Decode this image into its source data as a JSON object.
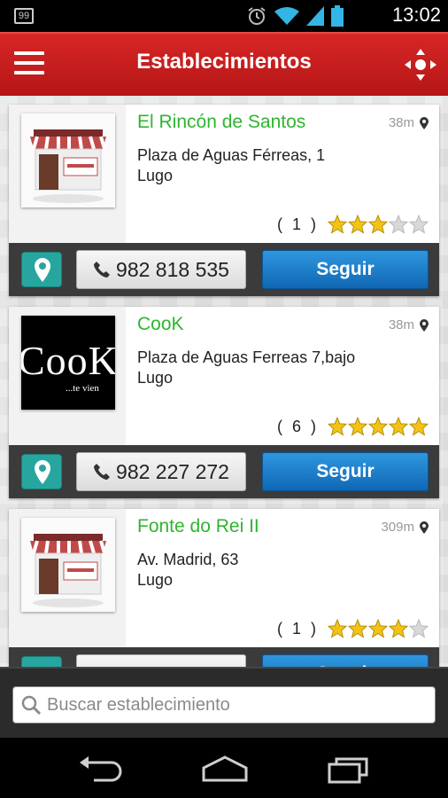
{
  "status_bar": {
    "notification_count": "99",
    "time": "13:02",
    "icons": [
      "alarm-icon",
      "wifi-icon",
      "signal-icon",
      "battery-icon"
    ]
  },
  "app_bar": {
    "title": "Establecimientos",
    "menu_icon": "hamburger-menu-icon",
    "locate_icon": "locate-crosshair-icon",
    "color": "#c91f1f"
  },
  "establishments": [
    {
      "name": "El Rincón de Santos",
      "distance": "38m",
      "address_line1": "Plaza de Aguas Férreas, 1",
      "address_line2": "Lugo",
      "rating_count": "( 1 )",
      "stars": 3,
      "phone": "982 818 535",
      "follow_label": "Seguir",
      "thumbnail": "shop-storefront"
    },
    {
      "name": "CooK",
      "distance": "38m",
      "address_line1": "Plaza de Aguas Ferreas 7,bajo",
      "address_line2": "Lugo",
      "rating_count": "( 6 )",
      "stars": 5,
      "phone": "982 227 272",
      "follow_label": "Seguir",
      "thumbnail": "cook-logo",
      "logo_text": "CooK",
      "logo_subtext": "...te vien"
    },
    {
      "name": "Fonte do Rei II",
      "distance": "309m",
      "address_line1": "Av. Madrid, 63",
      "address_line2": "Lugo",
      "rating_count": "( 1 )",
      "stars": 4,
      "phone": "",
      "follow_label": "Seguir",
      "thumbnail": "shop-storefront"
    }
  ],
  "search": {
    "placeholder": "Buscar establecimiento",
    "icon": "search-icon"
  },
  "colors": {
    "name_green": "#2fb52f",
    "follow_blue": "#1a7fcf",
    "map_teal": "#27a6a0",
    "star_gold": "#f2c316"
  },
  "nav_bar": {
    "icons": [
      "back-icon",
      "home-icon",
      "recent-apps-icon"
    ]
  }
}
